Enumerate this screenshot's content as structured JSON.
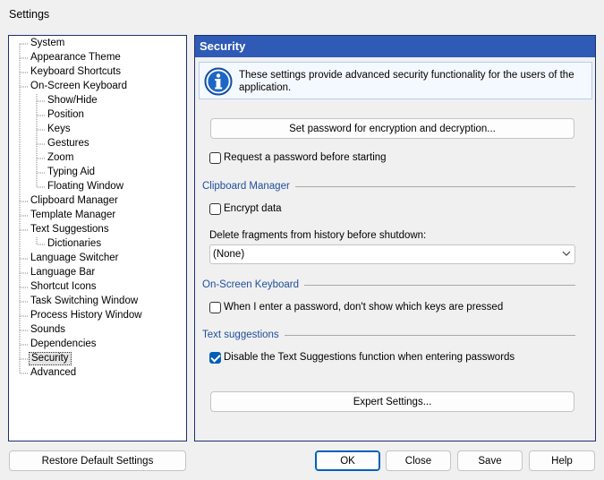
{
  "window": {
    "title": "Settings"
  },
  "tree": {
    "items": [
      {
        "label": "System",
        "level": 0
      },
      {
        "label": "Appearance Theme",
        "level": 0
      },
      {
        "label": "Keyboard Shortcuts",
        "level": 0
      },
      {
        "label": "On-Screen Keyboard",
        "level": 0
      },
      {
        "label": "Show/Hide",
        "level": 1
      },
      {
        "label": "Position",
        "level": 1
      },
      {
        "label": "Keys",
        "level": 1
      },
      {
        "label": "Gestures",
        "level": 1
      },
      {
        "label": "Zoom",
        "level": 1
      },
      {
        "label": "Typing Aid",
        "level": 1
      },
      {
        "label": "Floating Window",
        "level": 1
      },
      {
        "label": "Clipboard Manager",
        "level": 0
      },
      {
        "label": "Template Manager",
        "level": 0
      },
      {
        "label": "Text Suggestions",
        "level": 0
      },
      {
        "label": "Dictionaries",
        "level": 1
      },
      {
        "label": "Language Switcher",
        "level": 0
      },
      {
        "label": "Language Bar",
        "level": 0
      },
      {
        "label": "Shortcut Icons",
        "level": 0
      },
      {
        "label": "Task Switching Window",
        "level": 0
      },
      {
        "label": "Process History Window",
        "level": 0
      },
      {
        "label": "Sounds",
        "level": 0
      },
      {
        "label": "Dependencies",
        "level": 0
      },
      {
        "label": "Security",
        "level": 0,
        "selected": true
      },
      {
        "label": "Advanced",
        "level": 0
      }
    ]
  },
  "panel": {
    "title": "Security",
    "info_text": "These settings provide advanced security functionality for the users of the application.",
    "set_password_button": "Set password for encryption and decryption...",
    "request_password": {
      "label": "Request a password before starting",
      "checked": false
    },
    "clipboard_section": "Clipboard Manager",
    "encrypt_data": {
      "label": "Encrypt data",
      "checked": false
    },
    "delete_fragments_label": "Delete fragments from history before shutdown:",
    "delete_fragments_value": "(None)",
    "osk_section": "On-Screen Keyboard",
    "hide_keys": {
      "label": "When I enter a password, don't show which keys are pressed",
      "checked": false
    },
    "text_suggestions_section": "Text suggestions",
    "disable_suggestions": {
      "label": "Disable the Text Suggestions function when entering passwords",
      "checked": true
    },
    "expert_button": "Expert Settings..."
  },
  "footer": {
    "restore_button": "Restore Default Settings",
    "ok_button": "OK",
    "close_button": "Close",
    "save_button": "Save",
    "help_button": "Help"
  },
  "colors": {
    "header_bg": "#2f5bb7",
    "accent": "#005fb8",
    "section_text": "#1f4e9c"
  }
}
